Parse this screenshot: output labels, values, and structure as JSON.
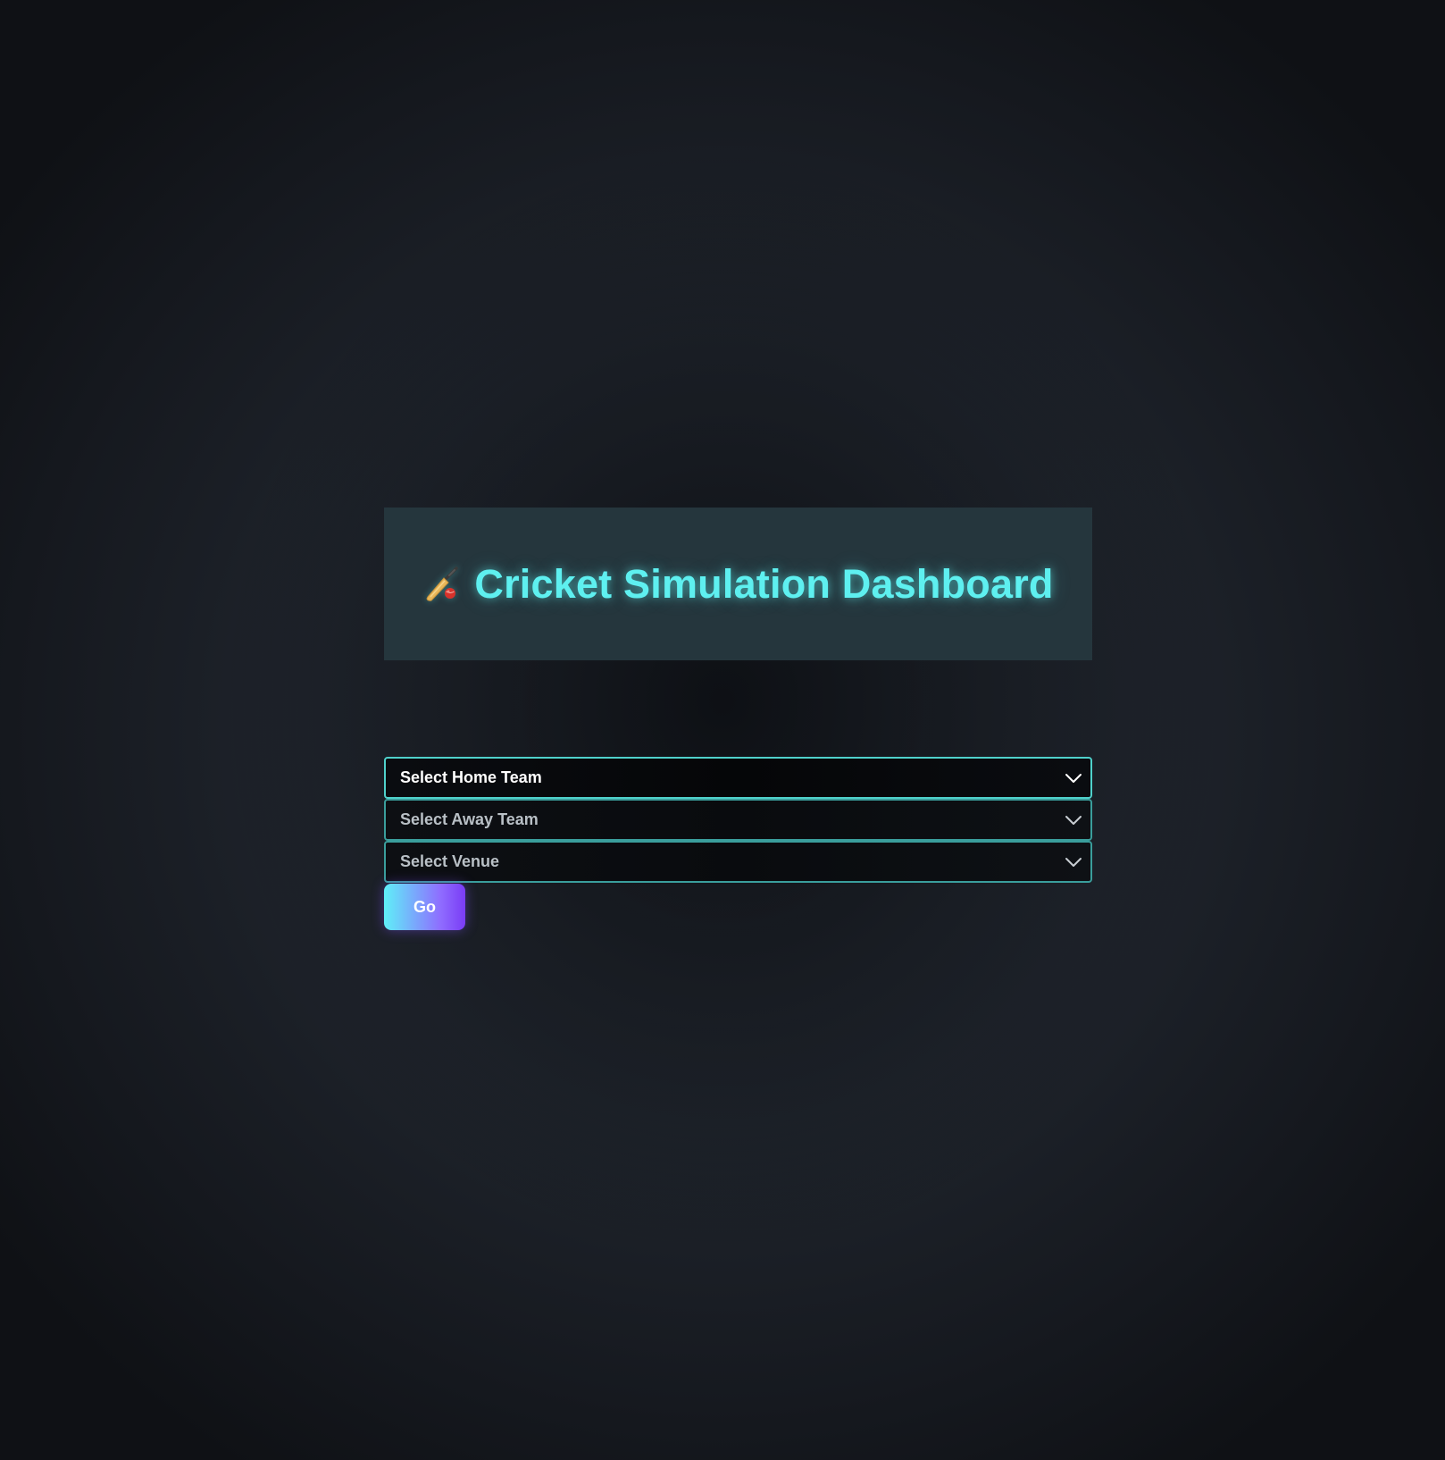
{
  "header": {
    "icon": "cricket-bat-icon",
    "title": "Cricket Simulation Dashboard"
  },
  "form": {
    "home_team": {
      "placeholder": "Select Home Team",
      "icon": "chevron-down-icon"
    },
    "away_team": {
      "placeholder": "Select Away Team",
      "icon": "chevron-down-icon"
    },
    "venue": {
      "placeholder": "Select Venue",
      "icon": "chevron-down-icon"
    },
    "go_label": "Go"
  },
  "colors": {
    "title": "#5ef0f0",
    "header_bg": "#25363d",
    "select_border": "#3a9e9c",
    "button_gradient_start": "#5ff0f8",
    "button_gradient_end": "#7a3cf5"
  }
}
